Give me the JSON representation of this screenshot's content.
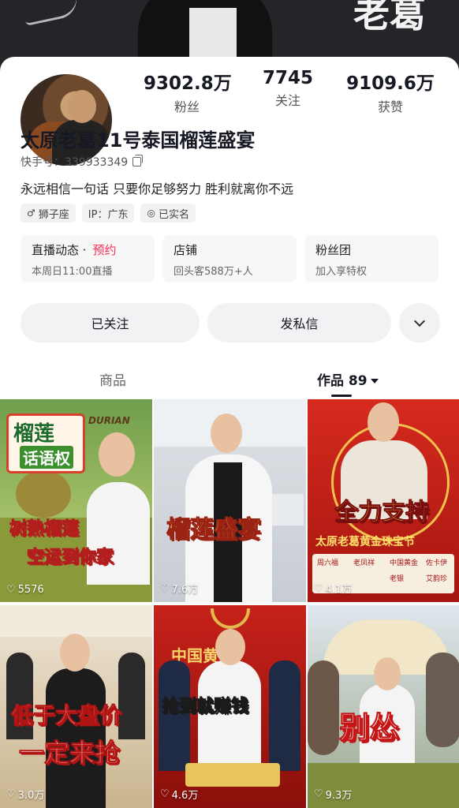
{
  "header": {
    "banner_text": "老葛"
  },
  "profile": {
    "stats": [
      {
        "value": "9302.8万",
        "label": "粉丝"
      },
      {
        "value": "7745",
        "label": "关注"
      },
      {
        "value": "9109.6万",
        "label": "获赞"
      }
    ],
    "name": "太原老葛11号泰国榴莲盛宴",
    "kuaishou_id": "快手号：339933349",
    "bio": "永远相信一句话 只要你足够努力 胜利就离你不远",
    "tags": [
      {
        "icon": "male-icon",
        "glyph": "♂",
        "label": "狮子座"
      },
      {
        "icon": "",
        "glyph": "",
        "label": "IP：广东"
      },
      {
        "icon": "verified-shield-icon",
        "glyph": "◎",
        "label": "已实名"
      }
    ]
  },
  "features": [
    {
      "title": "直播动态 ·",
      "accent": "预约",
      "subtitle": "本周日11:00直播"
    },
    {
      "title": "店铺",
      "accent": "",
      "subtitle": "回头客588万+人"
    },
    {
      "title": "粉丝团",
      "accent": "",
      "subtitle": "加入享特权"
    }
  ],
  "actions": {
    "follow_label": "已关注",
    "message_label": "发私信"
  },
  "tabs": {
    "goods": "商品",
    "works": "作品 89"
  },
  "videos": [
    {
      "title_line1": "榴莲",
      "title_line2": "话语权",
      "badge": "DURIAN",
      "caption_line1": "树熟榴莲",
      "caption_line2": "空运到你家",
      "likes": "5576"
    },
    {
      "caption_line1": "榴莲盛宴",
      "likes": "7.6万"
    },
    {
      "caption_line1": "全力支持",
      "caption_line2": "太原老葛黄金珠宝节",
      "brands": [
        "周六福",
        "老凤祥",
        "中国黄金",
        "佐卡伊",
        "老银",
        "艾韵珍"
      ],
      "likes": "4.1万"
    },
    {
      "caption_line1": "低于大盘价",
      "caption_line2": "一定来抢",
      "likes": "3.0万"
    },
    {
      "sign": "中国黄金",
      "caption_line1": "抢到就赚钱",
      "likes": "4.6万"
    },
    {
      "caption_line1": "别怂",
      "likes": "9.3万"
    }
  ],
  "colors": {
    "accent": "#fe2c55",
    "text": "#161823",
    "chip_bg": "#f2f2f4"
  }
}
